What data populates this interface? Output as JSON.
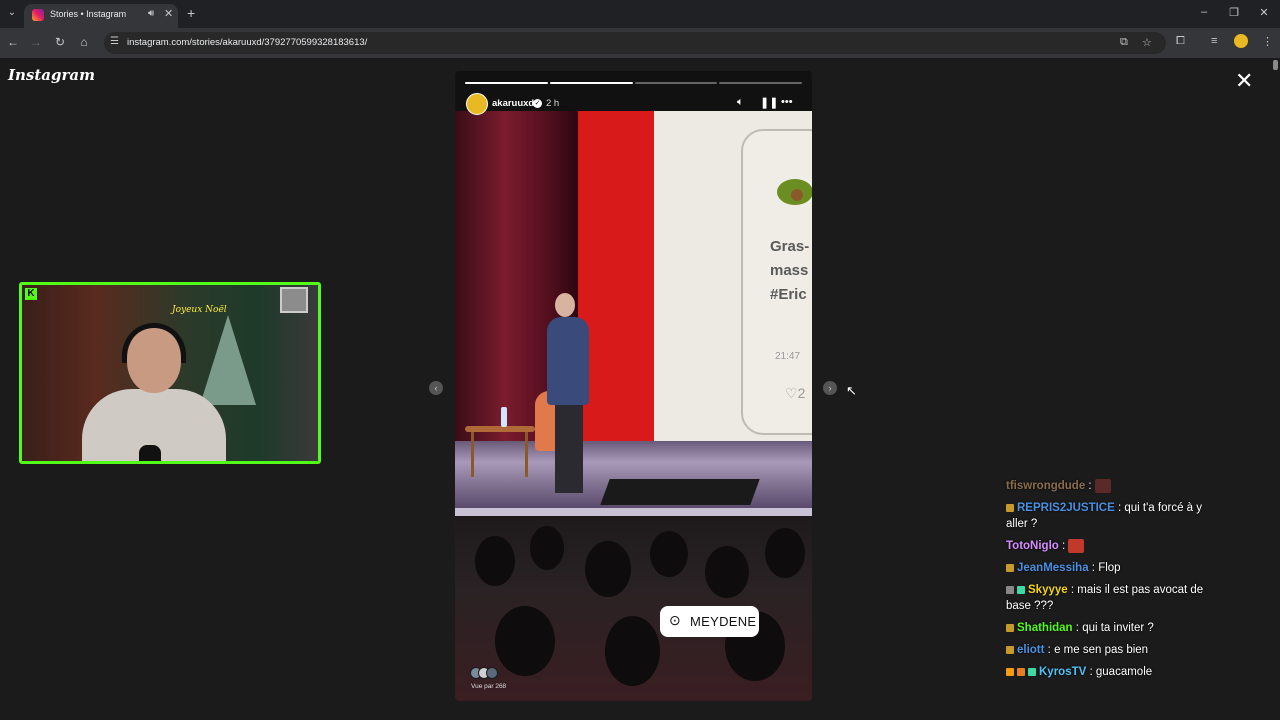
{
  "browser": {
    "tab_title": "Stories • Instagram",
    "url": "instagram.com/stories/akaruuxd/3792770599328183613/"
  },
  "page": {
    "logo": "Instagram",
    "close_label": "✕"
  },
  "story": {
    "username": "akaruuxd",
    "time_ago": "2 h",
    "progress_segments": [
      true,
      true,
      false,
      false
    ],
    "location": "MEYDENE",
    "seen_by": "Vue par 268",
    "screen_text": [
      "Gras-",
      "mass",
      "#Eric"
    ],
    "screen_time": "21:47",
    "screen_likes": "2"
  },
  "webcam": {
    "neon_text": "Joyeux Noël"
  },
  "chat": {
    "messages": [
      {
        "user": "tfiswrongdude",
        "color": "#8a6d4b",
        "text": "",
        "badges": [],
        "emote": true,
        "emote_color": "#5a2a2a"
      },
      {
        "user": "REPRIS2JUSTICE",
        "color": "#4a90e2",
        "text": "qui t'a forcé à y aller ?",
        "badges": [
          "#c69a2a"
        ],
        "emote": false
      },
      {
        "user": "TotoNiglo",
        "color": "#d58cff",
        "text": "",
        "badges": [],
        "emote": true,
        "emote_color": "#c0392b"
      },
      {
        "user": "JeanMessiha",
        "color": "#4a90e2",
        "text": "Flop",
        "badges": [
          "#c69a2a"
        ],
        "emote": false
      },
      {
        "user": "Skyyye",
        "color": "#f5d60a",
        "text": "mais il est pas avocat de base ???",
        "badges": [
          "#888888",
          "#3fd9a8"
        ],
        "emote": false
      },
      {
        "user": "Shathidan",
        "color": "#53fc18",
        "text": "qui ta inviter ?",
        "badges": [
          "#c69a2a"
        ],
        "emote": false
      },
      {
        "user": "eliott",
        "color": "#4a90e2",
        "text": "e me sen pas bien",
        "badges": [
          "#c69a2a"
        ],
        "emote": false
      },
      {
        "user": "KyrosTV",
        "color": "#4fc3f7",
        "text": "guacamole",
        "badges": [
          "#f39c12",
          "#e67e22",
          "#3fd9a8"
        ],
        "emote": false
      }
    ]
  },
  "colors": {
    "kick_green": "#53fc18",
    "page_bg": "#1b1b1b"
  }
}
